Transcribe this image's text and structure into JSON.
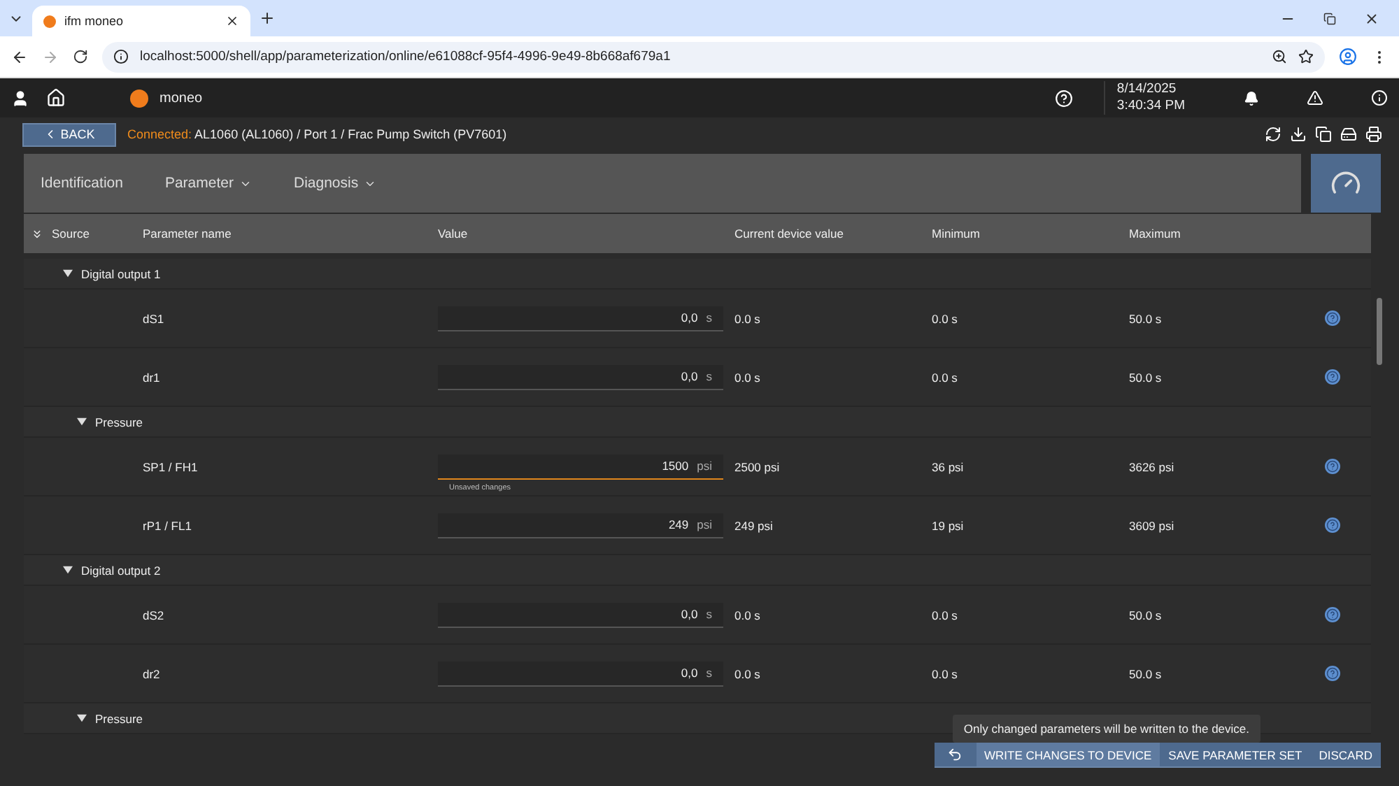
{
  "browser": {
    "tabs": [
      {
        "title": "ifm moneo",
        "selected": true
      }
    ],
    "url": "localhost:5000/shell/app/parameterization/online/e61088cf-95f4-4996-9e49-8b668af679a1"
  },
  "header": {
    "brand": "moneo",
    "date": "8/14/2025",
    "time": "3:40:34 PM"
  },
  "subheader": {
    "back": "BACK",
    "status": "Connected:",
    "path": "AL1060 (AL1060) / Port 1 / Frac Pump Switch (PV7601)"
  },
  "nav": [
    {
      "label": "Identification",
      "has_menu": false
    },
    {
      "label": "Parameter",
      "has_menu": true
    },
    {
      "label": "Diagnosis",
      "has_menu": true
    }
  ],
  "columns": [
    "Source",
    "Parameter name",
    "Value",
    "Current device value",
    "Minimum",
    "Maximum"
  ],
  "rows": [
    {
      "kind": "group",
      "label": "Digital output 1",
      "expanded": true,
      "children": [
        {
          "kind": "param",
          "name": "dS1",
          "value": "0,0",
          "unit": "s",
          "current": "0.0 s",
          "minimum": "0.0 s",
          "maximum": "50.0 s",
          "modified": false
        },
        {
          "kind": "param",
          "name": "dr1",
          "value": "0,0",
          "unit": "s",
          "current": "0.0 s",
          "minimum": "0.0 s",
          "maximum": "50.0 s",
          "modified": false
        },
        {
          "kind": "group",
          "label": "Pressure",
          "expanded": true,
          "children": [
            {
              "kind": "param",
              "name": "SP1 / FH1",
              "value": "1500",
              "unit": "psi",
              "current": "2500 psi",
              "minimum": "36 psi",
              "maximum": "3626 psi",
              "modified": true,
              "note": "Unsaved changes"
            },
            {
              "kind": "param",
              "name": "rP1 / FL1",
              "value": "249",
              "unit": "psi",
              "current": "249 psi",
              "minimum": "19 psi",
              "maximum": "3609 psi",
              "modified": false
            }
          ]
        }
      ]
    },
    {
      "kind": "group",
      "label": "Digital output 2",
      "expanded": true,
      "children": [
        {
          "kind": "param",
          "name": "dS2",
          "value": "0,0",
          "unit": "s",
          "current": "0.0 s",
          "minimum": "0.0 s",
          "maximum": "50.0 s",
          "modified": false
        },
        {
          "kind": "param",
          "name": "dr2",
          "value": "0,0",
          "unit": "s",
          "current": "0.0 s",
          "minimum": "0.0 s",
          "maximum": "50.0 s",
          "modified": false
        },
        {
          "kind": "group",
          "label": "Pressure",
          "expanded": true
        }
      ]
    }
  ],
  "tooltip": "Only changed parameters will be written to the device.",
  "actions": [
    {
      "label": "WRITE CHANGES TO DEVICE",
      "hovered": true
    },
    {
      "label": "SAVE PARAMETER SET",
      "hovered": false
    },
    {
      "label": "DISCARD",
      "hovered": false
    }
  ]
}
